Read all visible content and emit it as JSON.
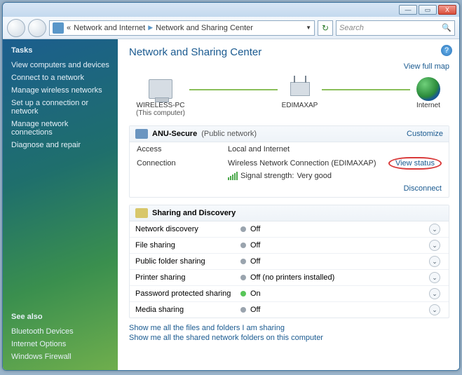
{
  "titlebar": {
    "min": "—",
    "max": "▭",
    "close": "X"
  },
  "address": {
    "prefix": "«",
    "seg1": "Network and Internet",
    "seg2": "Network and Sharing Center",
    "search_placeholder": "Search"
  },
  "sidebar": {
    "tasks_heading": "Tasks",
    "items": [
      "View computers and devices",
      "Connect to a network",
      "Manage wireless networks",
      "Set up a connection or network",
      "Manage network connections",
      "Diagnose and repair"
    ],
    "seealso_heading": "See also",
    "seealso": [
      "Bluetooth Devices",
      "Internet Options",
      "Windows Firewall"
    ]
  },
  "page": {
    "title": "Network and Sharing Center",
    "view_full_map": "View full map",
    "map": {
      "pc_name": "WIRELESS-PC",
      "pc_sub": "(This computer)",
      "ap_name": "EDIMAXAP",
      "internet": "Internet"
    },
    "network": {
      "name": "ANU-Secure",
      "type": "(Public network)",
      "customize": "Customize",
      "access_label": "Access",
      "access_value": "Local and Internet",
      "connection_label": "Connection",
      "connection_value_prefix": "Wireless Network Connection (",
      "connection_value_ap": "EDIMAXAP",
      "connection_value_suffix": ")",
      "view_status": "View status",
      "signal_label": "Signal strength:",
      "signal_value": "Very good",
      "disconnect": "Disconnect"
    },
    "sharing": {
      "heading": "Sharing and Discovery",
      "rows": [
        {
          "label": "Network discovery",
          "value": "Off",
          "on": false
        },
        {
          "label": "File sharing",
          "value": "Off",
          "on": false
        },
        {
          "label": "Public folder sharing",
          "value": "Off",
          "on": false
        },
        {
          "label": "Printer sharing",
          "value": "Off (no printers installed)",
          "on": false
        },
        {
          "label": "Password protected sharing",
          "value": "On",
          "on": true
        },
        {
          "label": "Media sharing",
          "value": "Off",
          "on": false
        }
      ]
    },
    "bottom_links": [
      "Show me all the files and folders I am sharing",
      "Show me all the shared network folders on this computer"
    ]
  }
}
